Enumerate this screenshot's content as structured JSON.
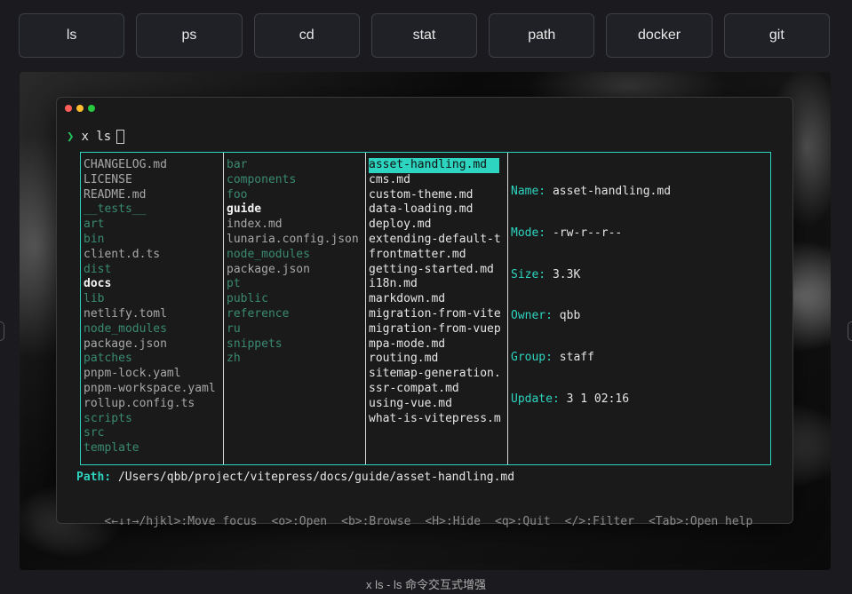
{
  "tabs": [
    "ls",
    "ps",
    "cd",
    "stat",
    "path",
    "docker",
    "git"
  ],
  "terminal": {
    "prompt_symbol": "❯",
    "command": "x ls",
    "columns": [
      [
        {
          "text": "CHANGELOG.md",
          "kind": "file"
        },
        {
          "text": "LICENSE",
          "kind": "file"
        },
        {
          "text": "README.md",
          "kind": "file"
        },
        {
          "text": "__tests__",
          "kind": "dir"
        },
        {
          "text": "art",
          "kind": "dir"
        },
        {
          "text": "bin",
          "kind": "dir"
        },
        {
          "text": "client.d.ts",
          "kind": "file"
        },
        {
          "text": "dist",
          "kind": "dir"
        },
        {
          "text": "docs",
          "kind": "bold"
        },
        {
          "text": "lib",
          "kind": "dir"
        },
        {
          "text": "netlify.toml",
          "kind": "file"
        },
        {
          "text": "node_modules",
          "kind": "dir"
        },
        {
          "text": "package.json",
          "kind": "file"
        },
        {
          "text": "patches",
          "kind": "dir"
        },
        {
          "text": "pnpm-lock.yaml",
          "kind": "file"
        },
        {
          "text": "pnpm-workspace.yaml",
          "kind": "file"
        },
        {
          "text": "rollup.config.ts",
          "kind": "file"
        },
        {
          "text": "scripts",
          "kind": "dir"
        },
        {
          "text": "src",
          "kind": "dir"
        },
        {
          "text": "template",
          "kind": "dir"
        }
      ],
      [
        {
          "text": "bar",
          "kind": "dir"
        },
        {
          "text": "components",
          "kind": "dir"
        },
        {
          "text": "foo",
          "kind": "dir"
        },
        {
          "text": "guide",
          "kind": "bold"
        },
        {
          "text": "index.md",
          "kind": "file"
        },
        {
          "text": "lunaria.config.json",
          "kind": "file"
        },
        {
          "text": "node_modules",
          "kind": "dir"
        },
        {
          "text": "package.json",
          "kind": "file"
        },
        {
          "text": "pt",
          "kind": "dir"
        },
        {
          "text": "public",
          "kind": "dir"
        },
        {
          "text": "reference",
          "kind": "dir"
        },
        {
          "text": "ru",
          "kind": "dir"
        },
        {
          "text": "snippets",
          "kind": "dir"
        },
        {
          "text": "zh",
          "kind": "dir"
        }
      ],
      [
        {
          "text": "asset-handling.md",
          "kind": "selected"
        },
        {
          "text": "cms.md",
          "kind": "plain"
        },
        {
          "text": "custom-theme.md",
          "kind": "plain"
        },
        {
          "text": "data-loading.md",
          "kind": "plain"
        },
        {
          "text": "deploy.md",
          "kind": "plain"
        },
        {
          "text": "extending-default-t",
          "kind": "plain"
        },
        {
          "text": "frontmatter.md",
          "kind": "plain"
        },
        {
          "text": "getting-started.md",
          "kind": "plain"
        },
        {
          "text": "i18n.md",
          "kind": "plain"
        },
        {
          "text": "markdown.md",
          "kind": "plain"
        },
        {
          "text": "migration-from-vite",
          "kind": "plain"
        },
        {
          "text": "migration-from-vuep",
          "kind": "plain"
        },
        {
          "text": "mpa-mode.md",
          "kind": "plain"
        },
        {
          "text": "routing.md",
          "kind": "plain"
        },
        {
          "text": "sitemap-generation.",
          "kind": "plain"
        },
        {
          "text": "ssr-compat.md",
          "kind": "plain"
        },
        {
          "text": "using-vue.md",
          "kind": "plain"
        },
        {
          "text": "what-is-vitepress.m",
          "kind": "plain"
        }
      ]
    ],
    "details": [
      "Name: asset-handling.md",
      "Mode: -rw-r--r--",
      "Size: 3.3K",
      "Owner: qbb",
      "Group: staff",
      "Update: 3 1 02:16"
    ],
    "path_label": "Path:",
    "path_value": "/Users/qbb/project/vitepress/docs/guide/asset-handling.md",
    "help": [
      "<←↓↑→/hjkl>:Move focus",
      "<o>:Open",
      "<b>:Browse",
      "<H>:Hide",
      "<q>:Quit",
      "</>:Filter",
      "<Tab>:Open help"
    ]
  },
  "caption": "x ls - ls 命令交互式增强",
  "colors": {
    "accent": "#2dd4bf",
    "directory": "#3a8a72",
    "prompt_arrow": "#22c55e"
  }
}
